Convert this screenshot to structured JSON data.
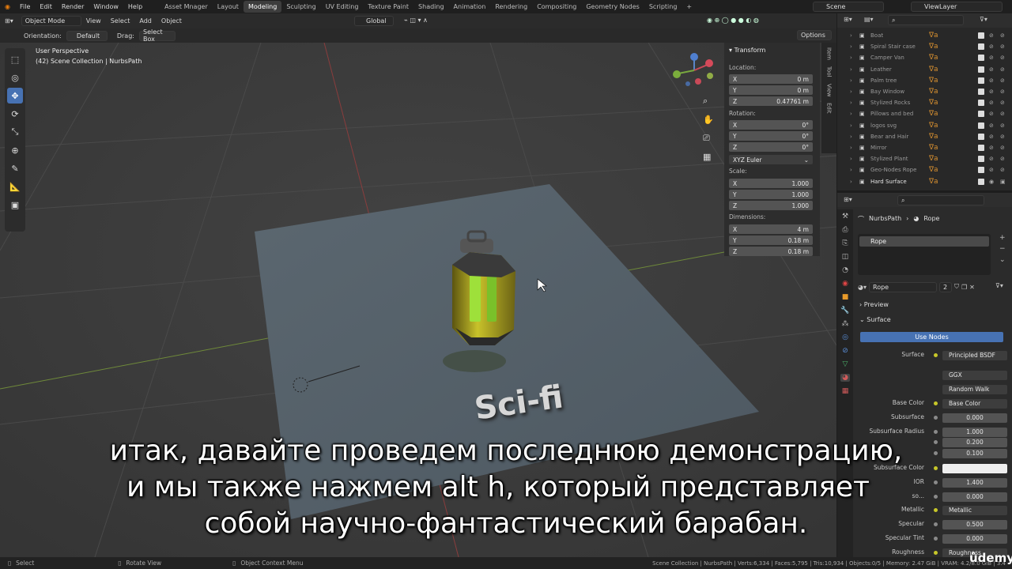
{
  "top_menu": [
    "File",
    "Edit",
    "Render",
    "Window",
    "Help"
  ],
  "workspaces": [
    "Asset Mnager",
    "Layout",
    "Modeling",
    "Sculpting",
    "UV Editing",
    "Texture Paint",
    "Shading",
    "Animation",
    "Rendering",
    "Compositing",
    "Geometry Nodes",
    "Scripting"
  ],
  "active_workspace": "Modeling",
  "scene": "Scene",
  "view_layer": "ViewLayer",
  "viewport": {
    "mode": "Object Mode",
    "menus": [
      "View",
      "Select",
      "Add",
      "Object"
    ],
    "transform_orientation": "Global",
    "orientation_label": "Orientation:",
    "orientation_value": "Default",
    "drag_label": "Drag:",
    "drag_value": "Select Box",
    "options": "Options",
    "perspective": "User Perspective",
    "collection_info": "(42) Scene Collection | NurbsPath",
    "scene_text": "Sci-fi"
  },
  "transform": {
    "title": "Transform",
    "location_label": "Location:",
    "location": [
      {
        "axis": "X",
        "value": "0 m"
      },
      {
        "axis": "Y",
        "value": "0 m"
      },
      {
        "axis": "Z",
        "value": "0.47761 m"
      }
    ],
    "rotation_label": "Rotation:",
    "rotation": [
      {
        "axis": "X",
        "value": "0°"
      },
      {
        "axis": "Y",
        "value": "0°"
      },
      {
        "axis": "Z",
        "value": "0°"
      }
    ],
    "rotation_mode": "XYZ Euler",
    "scale_label": "Scale:",
    "scale": [
      {
        "axis": "X",
        "value": "1.000"
      },
      {
        "axis": "Y",
        "value": "1.000"
      },
      {
        "axis": "Z",
        "value": "1.000"
      }
    ],
    "dimensions_label": "Dimensions:",
    "dimensions": [
      {
        "axis": "X",
        "value": "4 m"
      },
      {
        "axis": "Y",
        "value": "0.18 m"
      },
      {
        "axis": "Z",
        "value": "0.18 m"
      }
    ]
  },
  "n_tabs": [
    "Item",
    "Tool",
    "View",
    "Edit"
  ],
  "outliner": {
    "items": [
      "Boat",
      "Spiral Stair case",
      "Camper Van",
      "Leather",
      "Palm tree",
      "Bay Window",
      "Stylized Rocks",
      "Pillows and bed",
      "logos svg",
      "Bear and Hair",
      "Mirror",
      "Stylized Plant",
      "Geo-Nodes Rope",
      "Hard Surface"
    ]
  },
  "properties": {
    "breadcrumb_object": "NurbsPath",
    "breadcrumb_material": "Rope",
    "slot": "Rope",
    "material_name": "Rope",
    "users": "2",
    "preview": "Preview",
    "surface_section": "Surface",
    "use_nodes": "Use Nodes",
    "rows": [
      {
        "label": "Surface",
        "value": "Principled BSDF",
        "kind": "link"
      },
      {
        "label": "",
        "value": "GGX",
        "kind": "enum"
      },
      {
        "label": "",
        "value": "Random Walk",
        "kind": "enum"
      },
      {
        "label": "Base Color",
        "value": "Base Color",
        "kind": "link"
      },
      {
        "label": "Subsurface",
        "value": "0.000",
        "kind": "num"
      },
      {
        "label": "Subsurface Radius",
        "value": "1.000",
        "kind": "num"
      },
      {
        "label": "",
        "value": "0.200",
        "kind": "num"
      },
      {
        "label": "",
        "value": "0.100",
        "kind": "num"
      },
      {
        "label": "Subsurface Color",
        "value": "",
        "kind": "color"
      },
      {
        "label": "IOR",
        "value": "1.400",
        "kind": "num"
      },
      {
        "label": "so...",
        "value": "0.000",
        "kind": "num"
      },
      {
        "label": "Metallic",
        "value": "Metallic",
        "kind": "link"
      },
      {
        "label": "Specular",
        "value": "0.500",
        "kind": "num"
      },
      {
        "label": "Specular Tint",
        "value": "0.000",
        "kind": "num"
      },
      {
        "label": "Roughness",
        "value": "Roughness",
        "kind": "link"
      }
    ]
  },
  "status_bar": {
    "select": "Select",
    "rotate": "Rotate View",
    "context": "Object Context Menu",
    "stats": "Scene Collection | NurbsPath | Verts:6,334 | Faces:5,795 | Tris:10,934 | Objects:0/5 | Memory: 2.47 GiB | VRAM: 4.2/8.0 GiB | 3.4"
  },
  "subtitles": [
    "итак, давайте проведем последнюю демонстрацию,",
    "и мы также нажмем alt h, который представляет",
    "собой научно-фантастический барабан."
  ],
  "watermark": "ûdemy"
}
